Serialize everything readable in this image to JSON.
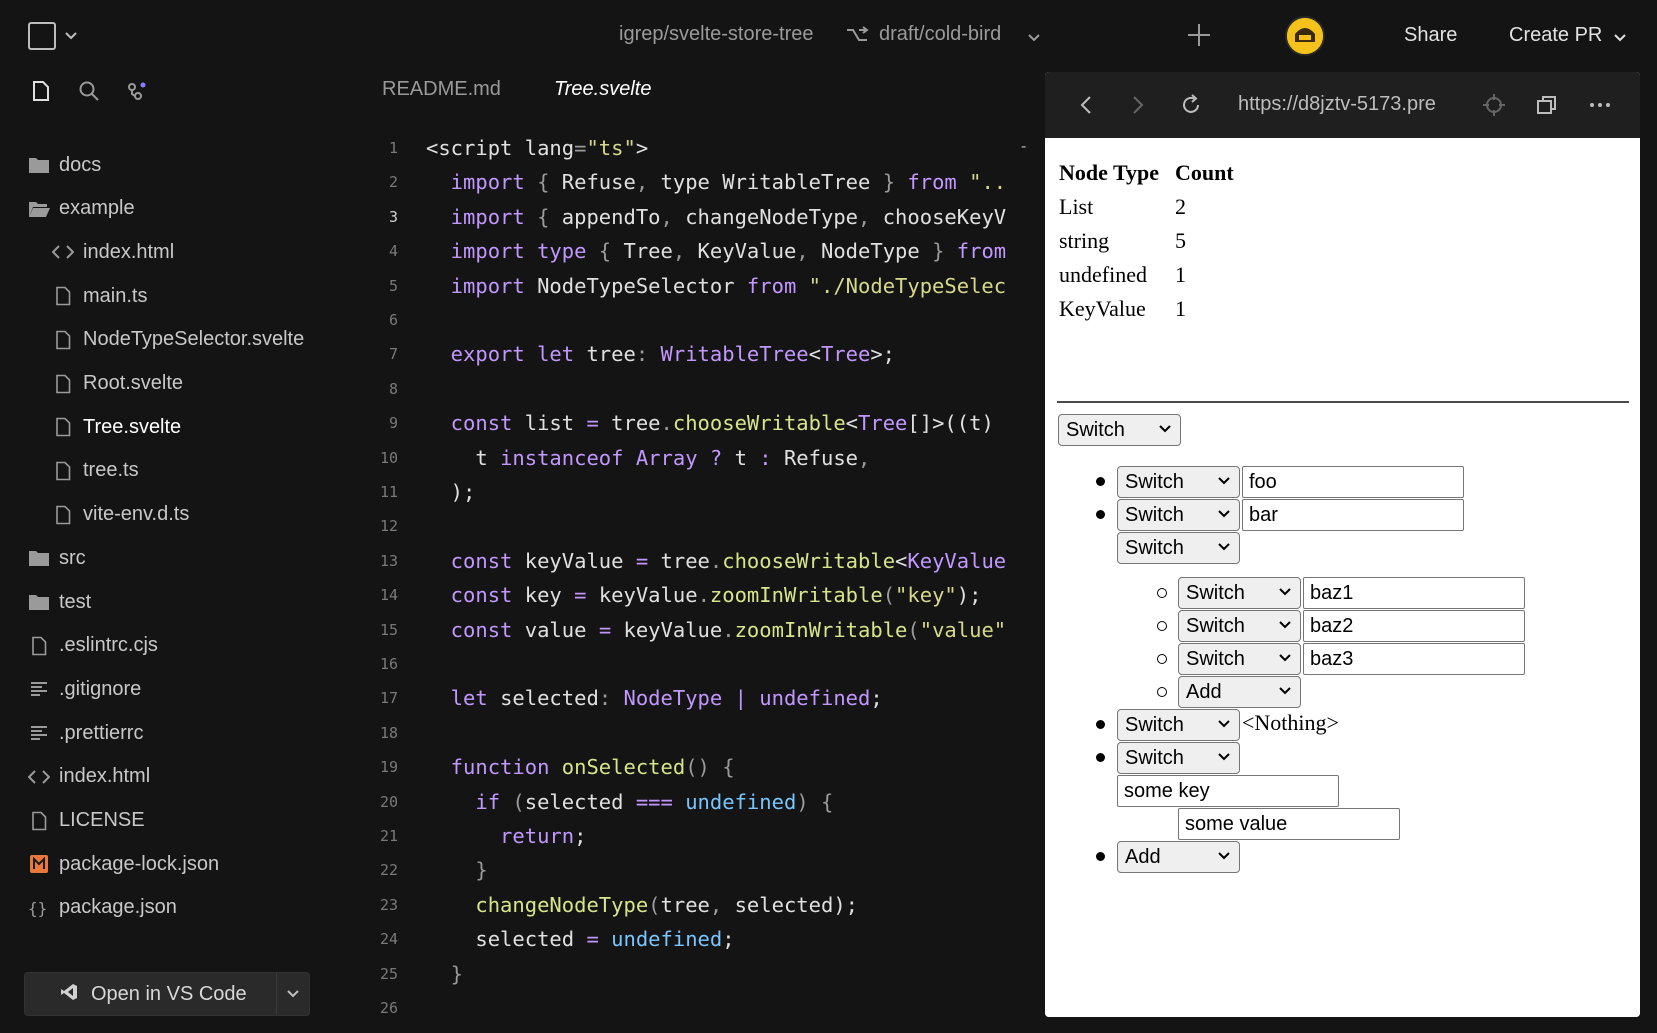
{
  "topbar": {
    "repo": "igrep/svelte-store-tree",
    "branch": "draft/cold-bird",
    "share": "Share",
    "create_pr": "Create PR"
  },
  "sidebar": {
    "items": [
      {
        "label": "docs",
        "icon": "folder-icon"
      },
      {
        "label": "example",
        "icon": "folder-open-icon"
      },
      {
        "label": "index.html",
        "icon": "code-icon"
      },
      {
        "label": "main.ts",
        "icon": "file-icon"
      },
      {
        "label": "NodeTypeSelector.svelte",
        "icon": "file-icon"
      },
      {
        "label": "Root.svelte",
        "icon": "file-icon"
      },
      {
        "label": "Tree.svelte",
        "icon": "file-icon"
      },
      {
        "label": "tree.ts",
        "icon": "file-icon"
      },
      {
        "label": "vite-env.d.ts",
        "icon": "file-icon"
      },
      {
        "label": "src",
        "icon": "folder-icon"
      },
      {
        "label": "test",
        "icon": "folder-icon"
      },
      {
        "label": ".eslintrc.cjs",
        "icon": "file-icon"
      },
      {
        "label": ".gitignore",
        "icon": "lines-icon"
      },
      {
        "label": ".prettierrc",
        "icon": "lines-icon"
      },
      {
        "label": "index.html",
        "icon": "code-icon"
      },
      {
        "label": "LICENSE",
        "icon": "file-icon"
      },
      {
        "label": "package-lock.json",
        "icon": "npm-icon"
      },
      {
        "label": "package.json",
        "icon": "braces-icon"
      }
    ],
    "open_vscode": "Open in VS Code"
  },
  "editor": {
    "tabs": [
      "README.md",
      "Tree.svelte"
    ],
    "active_tab": "Tree.svelte",
    "lines": [
      [
        {
          "t": "<script ",
          "c": "txt"
        },
        {
          "t": "lang",
          "c": "txt"
        },
        {
          "t": "=",
          "c": "pun"
        },
        {
          "t": "\"ts\"",
          "c": "str"
        },
        {
          "t": ">",
          "c": "txt"
        }
      ],
      [
        {
          "t": "  import ",
          "c": "kw"
        },
        {
          "t": "{ ",
          "c": "pun"
        },
        {
          "t": "Refuse",
          "c": "txt"
        },
        {
          "t": ", ",
          "c": "pun"
        },
        {
          "t": "type WritableTree ",
          "c": "txt"
        },
        {
          "t": "} ",
          "c": "pun"
        },
        {
          "t": "from ",
          "c": "kw"
        },
        {
          "t": "\"..",
          "c": "str"
        }
      ],
      [
        {
          "t": "  import ",
          "c": "kw"
        },
        {
          "t": "{ ",
          "c": "pun"
        },
        {
          "t": "appendTo",
          "c": "txt"
        },
        {
          "t": ", ",
          "c": "pun"
        },
        {
          "t": "changeNodeType",
          "c": "txt"
        },
        {
          "t": ", ",
          "c": "pun"
        },
        {
          "t": "chooseKeyV",
          "c": "txt"
        }
      ],
      [
        {
          "t": "  import type ",
          "c": "kw"
        },
        {
          "t": "{ ",
          "c": "pun"
        },
        {
          "t": "Tree",
          "c": "txt"
        },
        {
          "t": ", ",
          "c": "pun"
        },
        {
          "t": "KeyValue",
          "c": "txt"
        },
        {
          "t": ", ",
          "c": "pun"
        },
        {
          "t": "NodeType ",
          "c": "txt"
        },
        {
          "t": "} ",
          "c": "pun"
        },
        {
          "t": "from",
          "c": "kw"
        }
      ],
      [
        {
          "t": "  import ",
          "c": "kw"
        },
        {
          "t": "NodeTypeSelector ",
          "c": "txt"
        },
        {
          "t": "from ",
          "c": "kw"
        },
        {
          "t": "\"./NodeTypeSelec",
          "c": "str"
        }
      ],
      [],
      [
        {
          "t": "  export let ",
          "c": "kw"
        },
        {
          "t": "tree",
          "c": "txt"
        },
        {
          "t": ": ",
          "c": "pun"
        },
        {
          "t": "WritableTree",
          "c": "ty"
        },
        {
          "t": "<",
          "c": "txt"
        },
        {
          "t": "Tree",
          "c": "ty"
        },
        {
          "t": ">;",
          "c": "txt"
        }
      ],
      [],
      [
        {
          "t": "  const ",
          "c": "kw"
        },
        {
          "t": "list ",
          "c": "txt"
        },
        {
          "t": "= ",
          "c": "kw"
        },
        {
          "t": "tree",
          "c": "txt"
        },
        {
          "t": ".",
          "c": "pun"
        },
        {
          "t": "chooseWritable",
          "c": "fn"
        },
        {
          "t": "<",
          "c": "txt"
        },
        {
          "t": "Tree",
          "c": "ty"
        },
        {
          "t": "[]>((t)",
          "c": "txt"
        }
      ],
      [
        {
          "t": "    t ",
          "c": "txt"
        },
        {
          "t": "instanceof ",
          "c": "kw"
        },
        {
          "t": "Array ",
          "c": "ty"
        },
        {
          "t": "? ",
          "c": "kw"
        },
        {
          "t": "t ",
          "c": "txt"
        },
        {
          "t": ": ",
          "c": "kw"
        },
        {
          "t": "Refuse",
          "c": "txt"
        },
        {
          "t": ",",
          "c": "pun"
        }
      ],
      [
        {
          "t": "  );",
          "c": "txt"
        }
      ],
      [],
      [
        {
          "t": "  const ",
          "c": "kw"
        },
        {
          "t": "keyValue ",
          "c": "txt"
        },
        {
          "t": "= ",
          "c": "kw"
        },
        {
          "t": "tree",
          "c": "txt"
        },
        {
          "t": ".",
          "c": "pun"
        },
        {
          "t": "chooseWritable",
          "c": "fn"
        },
        {
          "t": "<",
          "c": "txt"
        },
        {
          "t": "KeyValue",
          "c": "ty"
        }
      ],
      [
        {
          "t": "  const ",
          "c": "kw"
        },
        {
          "t": "key ",
          "c": "txt"
        },
        {
          "t": "= ",
          "c": "kw"
        },
        {
          "t": "keyValue",
          "c": "txt"
        },
        {
          "t": ".",
          "c": "pun"
        },
        {
          "t": "zoomInWritable",
          "c": "fn"
        },
        {
          "t": "(",
          "c": "pun"
        },
        {
          "t": "\"key\"",
          "c": "str"
        },
        {
          "t": ");",
          "c": "txt"
        }
      ],
      [
        {
          "t": "  const ",
          "c": "kw"
        },
        {
          "t": "value ",
          "c": "txt"
        },
        {
          "t": "= ",
          "c": "kw"
        },
        {
          "t": "keyValue",
          "c": "txt"
        },
        {
          "t": ".",
          "c": "pun"
        },
        {
          "t": "zoomInWritable",
          "c": "fn"
        },
        {
          "t": "(",
          "c": "pun"
        },
        {
          "t": "\"value\"",
          "c": "str"
        }
      ],
      [],
      [
        {
          "t": "  let ",
          "c": "kw"
        },
        {
          "t": "selected",
          "c": "txt"
        },
        {
          "t": ": ",
          "c": "pun"
        },
        {
          "t": "NodeType ",
          "c": "ty"
        },
        {
          "t": "| ",
          "c": "kw"
        },
        {
          "t": "undefined",
          "c": "ty"
        },
        {
          "t": ";",
          "c": "txt"
        }
      ],
      [],
      [
        {
          "t": "  function ",
          "c": "kw"
        },
        {
          "t": "onSelected",
          "c": "fn"
        },
        {
          "t": "() ",
          "c": "pun"
        },
        {
          "t": "{",
          "c": "pun"
        }
      ],
      [
        {
          "t": "    if ",
          "c": "kw"
        },
        {
          "t": "(",
          "c": "pun"
        },
        {
          "t": "selected ",
          "c": "txt"
        },
        {
          "t": "=== ",
          "c": "kw"
        },
        {
          "t": "undefined",
          "c": "con"
        },
        {
          "t": ") ",
          "c": "pun"
        },
        {
          "t": "{",
          "c": "pun"
        }
      ],
      [
        {
          "t": "      return",
          "c": "kw"
        },
        {
          "t": ";",
          "c": "txt"
        }
      ],
      [
        {
          "t": "    }",
          "c": "pun"
        }
      ],
      [
        {
          "t": "    changeNodeType",
          "c": "fn"
        },
        {
          "t": "(",
          "c": "pun"
        },
        {
          "t": "tree",
          "c": "txt"
        },
        {
          "t": ", ",
          "c": "pun"
        },
        {
          "t": "selected",
          "c": "txt"
        },
        {
          "t": ");",
          "c": "txt"
        }
      ],
      [
        {
          "t": "    selected ",
          "c": "txt"
        },
        {
          "t": "= ",
          "c": "kw"
        },
        {
          "t": "undefined",
          "c": "con"
        },
        {
          "t": ";",
          "c": "txt"
        }
      ],
      [
        {
          "t": "  }",
          "c": "pun"
        }
      ],
      []
    ],
    "current_line": 3
  },
  "preview": {
    "url": "https://d8jztv-5173.pre",
    "table": {
      "headers": [
        "Node Type",
        "Count"
      ],
      "rows": [
        [
          "List",
          "2"
        ],
        [
          "string",
          "5"
        ],
        [
          "undefined",
          "1"
        ],
        [
          "KeyValue",
          "1"
        ]
      ]
    },
    "switch_label": "Switch",
    "add_label": "Add",
    "nothing_label": "<Nothing>",
    "inputs": {
      "foo": "foo",
      "bar": "bar",
      "baz1": "baz1",
      "baz2": "baz2",
      "baz3": "baz3",
      "key": "some key",
      "value": "some value"
    }
  },
  "colors": {
    "background": "#141414",
    "keyword": "#c297ff",
    "string": "#d7d98a",
    "function": "#d7e58a",
    "constant": "#79c6ff",
    "avatar": "#f4c21a"
  }
}
